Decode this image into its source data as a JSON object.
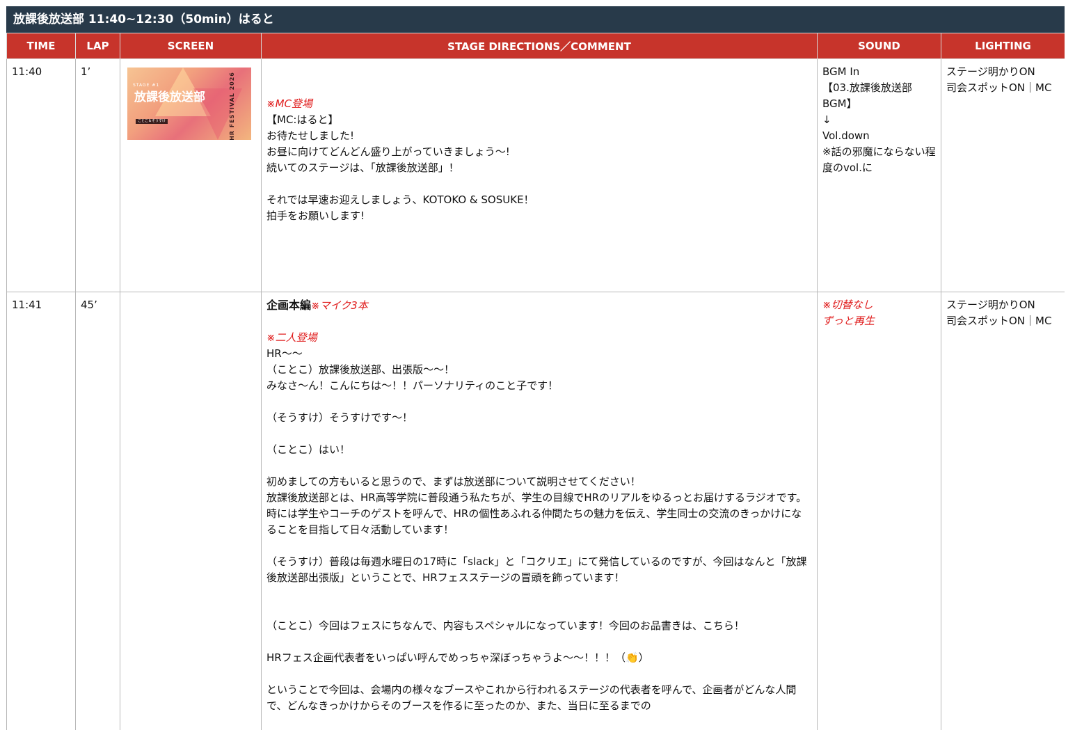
{
  "sheet_title": "放課後放送部  11:40~12:30（50min）はると",
  "columns": [
    "TIME",
    "LAP",
    "SCREEN",
    "STAGE DIRECTIONS／COMMENT",
    "SOUND",
    "LIGHTING"
  ],
  "rows": [
    {
      "time": "11:40",
      "lap": "1’",
      "screen_thumbnail": {
        "stage_no": "STAGE #1",
        "logo": "放課後放送部",
        "caption": "ことこ＆そうすけ",
        "festival": "HR FESTIVAL 2026"
      },
      "directions": [
        {
          "text": "",
          "style": "gap"
        },
        {
          "text": "",
          "style": "gap"
        },
        {
          "text": "※MC登場",
          "style": "red"
        },
        {
          "text": "【MC:はると】",
          "style": ""
        },
        {
          "text": "お待たせしました!",
          "style": ""
        },
        {
          "text": "お昼に向けてどんどん盛り上がっていきましょう〜!",
          "style": ""
        },
        {
          "text": "続いてのステージは、「放課後放送部」！",
          "style": ""
        },
        {
          "text": "",
          "style": "gap"
        },
        {
          "text": "それでは早速お迎えしましょう、KOTOKO & SOSUKE！",
          "style": ""
        },
        {
          "text": "拍手をお願いします!",
          "style": ""
        }
      ],
      "sound": [
        {
          "text": "BGM In",
          "style": ""
        },
        {
          "text": "【03.放課後放送部BGM】",
          "style": ""
        },
        {
          "text": "↓",
          "style": ""
        },
        {
          "text": "Vol.down",
          "style": ""
        },
        {
          "text": "※話の邪魔にならない程度のvol.に",
          "style": ""
        }
      ],
      "lighting": [
        {
          "text": "ステージ明かりON",
          "style": ""
        },
        {
          "text": "司会スポットON｜MC",
          "style": ""
        }
      ]
    },
    {
      "time": "11:41",
      "lap": "45’",
      "directions_heading": "企画本編",
      "directions_heading_note": "※マイク3本",
      "directions": [
        {
          "text": "",
          "style": "gap"
        },
        {
          "text": "※二人登場",
          "style": "red"
        },
        {
          "text": "HR〜〜",
          "style": ""
        },
        {
          "text": "（ことこ）放課後放送部、出張版〜〜！",
          "style": ""
        },
        {
          "text": "みなさ〜ん！こんにちは〜！！パーソナリティのこと子です！",
          "style": ""
        },
        {
          "text": "",
          "style": "gap"
        },
        {
          "text": "（そうすけ）そうすけです〜！",
          "style": ""
        },
        {
          "text": "",
          "style": "gap"
        },
        {
          "text": "（ことこ）はい！",
          "style": ""
        },
        {
          "text": "",
          "style": "gap"
        },
        {
          "text": "初めましての方もいると思うので、まずは放送部について説明させてください！",
          "style": ""
        },
        {
          "text": "放課後放送部とは、HR高等学院に普段通う私たちが、学生の目線でHRのリアルをゆるっとお届けするラジオです。時には学生やコーチのゲストを呼んで、HRの個性あふれる仲間たちの魅力を伝え、学生同士の交流のきっかけになることを目指して日々活動しています！",
          "style": ""
        },
        {
          "text": "",
          "style": "gap"
        },
        {
          "text": "（そうすけ）普段は毎週水曜日の17時に「slack」と「コクリエ」にて発信しているのですが、今回はなんと「放課後放送部出張版」ということで、HRフェスステージの冒頭を飾っています！",
          "style": ""
        },
        {
          "text": "",
          "style": "gap"
        },
        {
          "text": "",
          "style": "gap"
        },
        {
          "text": "（ことこ）今回はフェスにちなんで、内容もスペシャルになっています！今回のお品書きは、こちら！",
          "style": ""
        },
        {
          "text": "",
          "style": "gap"
        },
        {
          "text": "HRフェス企画代表者をいっぱい呼んでめっちゃ深ぼっちゃうよ〜〜！！！（👏）",
          "style": ""
        },
        {
          "text": "",
          "style": "gap"
        },
        {
          "text": "ということで今回は、会場内の様々なブースやこれから行われるステージの代表者を呼んで、企画者がどんな人間で、どんなきっかけからそのブースを作るに至ったのか、また、当日に至るまでの",
          "style": ""
        }
      ],
      "sound": [
        {
          "text": "※切替なし",
          "style": "red"
        },
        {
          "text": "ずっと再生",
          "style": "red"
        }
      ],
      "lighting": [
        {
          "text": "ステージ明かりON",
          "style": ""
        },
        {
          "text": "司会スポットON｜MC",
          "style": ""
        }
      ]
    }
  ]
}
